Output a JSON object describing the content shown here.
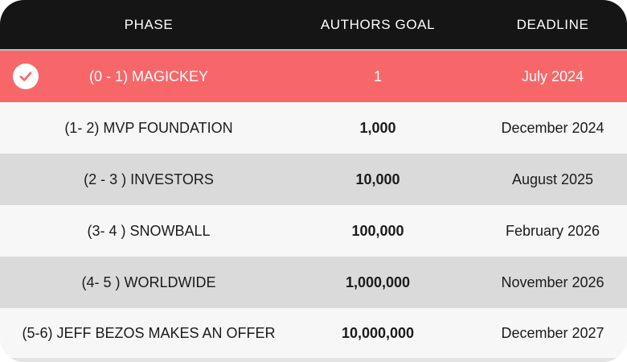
{
  "header": {
    "phase_label": "PHASE",
    "goal_label": "AUTHORS GOAL",
    "deadline_label": "DEADLINE"
  },
  "rows": [
    {
      "phase": "(0 - 1) MAGICKEY",
      "goal": "1",
      "deadline": "July 2024",
      "status": "completed"
    },
    {
      "phase": "(1- 2) MVP FOUNDATION",
      "goal": "1,000",
      "deadline": "December 2024"
    },
    {
      "phase": "(2 - 3 ) INVESTORS",
      "goal": "10,000",
      "deadline": "August 2025"
    },
    {
      "phase": "(3- 4 ) SNOWBALL",
      "goal": "100,000",
      "deadline": "February 2026"
    },
    {
      "phase": "(4- 5 ) WORLDWIDE",
      "goal": "1,000,000",
      "deadline": "November 2026"
    },
    {
      "phase": "(5-6) JEFF BEZOS MAKES AN OFFER",
      "goal": "10,000,000",
      "deadline": "December 2027"
    }
  ],
  "icons": {
    "completed": "check-circle-icon"
  },
  "colors": {
    "header_bg": "#151515",
    "current_row": "#f76769",
    "row_light": "#f7f7f7",
    "row_dark": "#dadada"
  }
}
